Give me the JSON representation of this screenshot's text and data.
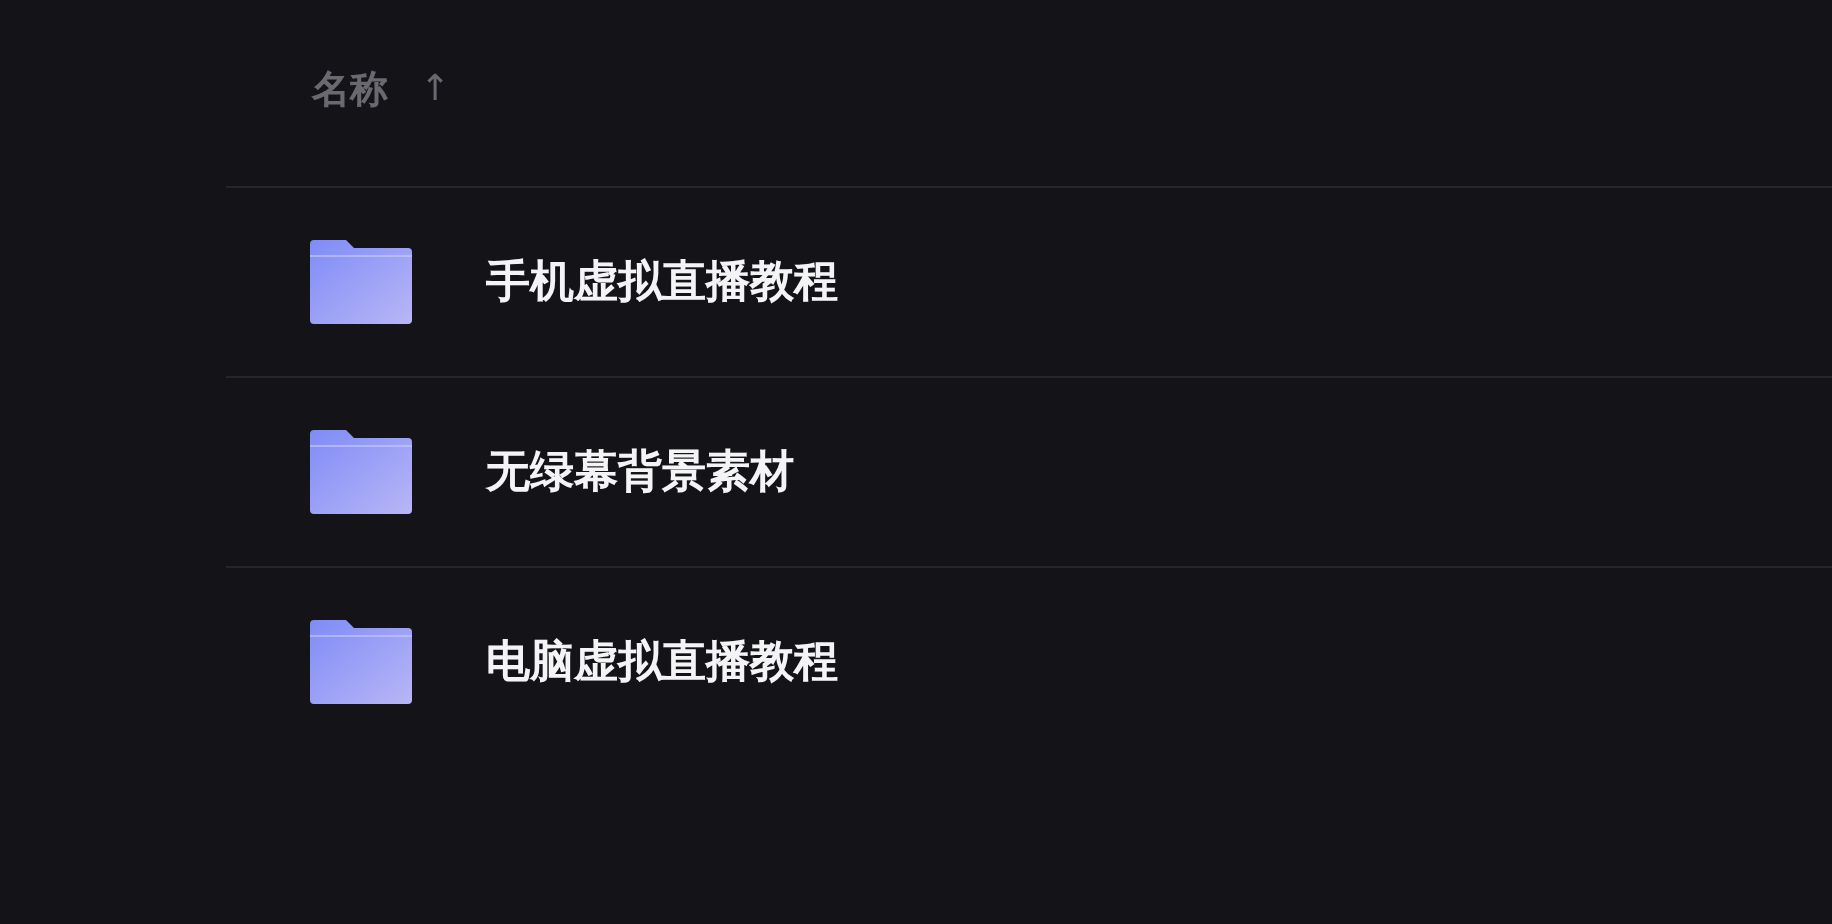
{
  "table": {
    "columns": [
      {
        "label": "名称",
        "sort_arrow": "↑"
      }
    ],
    "rows": [
      {
        "kind": "folder",
        "name": "手机虚拟直播教程"
      },
      {
        "kind": "folder",
        "name": "无绿幕背景素材"
      },
      {
        "kind": "folder",
        "name": "电脑虚拟直播教程"
      }
    ]
  }
}
